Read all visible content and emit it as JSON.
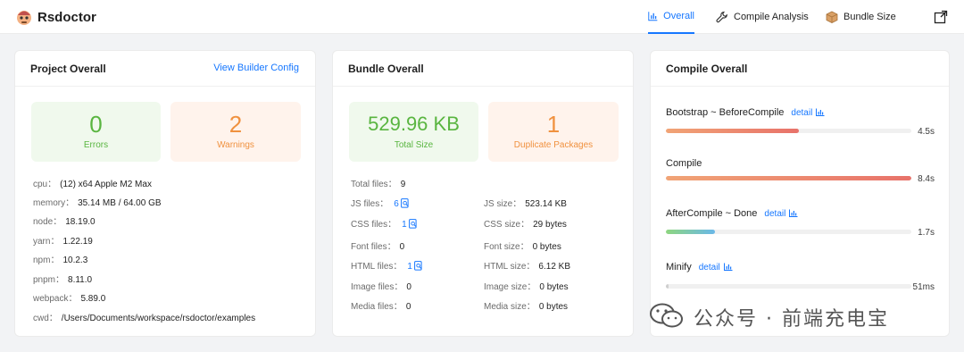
{
  "app": {
    "title": "Rsdoctor"
  },
  "nav": {
    "overall": "Overall",
    "compile_analysis": "Compile Analysis",
    "bundle_size": "Bundle Size"
  },
  "project": {
    "title": "Project Overall",
    "link": "View Builder Config",
    "errors": {
      "value": "0",
      "label": "Errors"
    },
    "warnings": {
      "value": "2",
      "label": "Warnings"
    },
    "info": [
      {
        "key": "cpu：",
        "value": "(12) x64 Apple M2 Max"
      },
      {
        "key": "memory：",
        "value": "35.14 MB / 64.00 GB"
      },
      {
        "key": "node：",
        "value": "18.19.0"
      },
      {
        "key": "yarn：",
        "value": "1.22.19"
      },
      {
        "key": "npm：",
        "value": "10.2.3"
      },
      {
        "key": "pnpm：",
        "value": "8.11.0"
      },
      {
        "key": "webpack：",
        "value": "5.89.0"
      },
      {
        "key": "cwd：",
        "value": "/Users/Documents/workspace/rsdoctor/examples"
      }
    ]
  },
  "bundle": {
    "title": "Bundle Overall",
    "total_size": {
      "value": "529.96 KB",
      "label": "Total Size"
    },
    "duplicates": {
      "value": "1",
      "label": "Duplicate Packages"
    },
    "left": [
      {
        "key": "Total files：",
        "value": "9"
      },
      {
        "key": "JS files：",
        "value": "6"
      },
      {
        "key": "CSS files：",
        "value": "1"
      },
      {
        "key": "Font files：",
        "value": "0"
      },
      {
        "key": "HTML files：",
        "value": "1"
      },
      {
        "key": "Image files：",
        "value": "0"
      },
      {
        "key": "Media files：",
        "value": "0"
      }
    ],
    "right": [
      {
        "key": "JS size：",
        "value": "523.14 KB"
      },
      {
        "key": "CSS size：",
        "value": "29 bytes"
      },
      {
        "key": "Font size：",
        "value": "0 bytes"
      },
      {
        "key": "HTML size：",
        "value": "6.12 KB"
      },
      {
        "key": "Image size：",
        "value": "0 bytes"
      },
      {
        "key": "Media size：",
        "value": "0 bytes"
      }
    ]
  },
  "compile": {
    "title": "Compile Overall",
    "detail_label": "detail",
    "phases": [
      {
        "name": "Bootstrap ~ BeforeCompile",
        "has_detail": true,
        "duration": "4.5s",
        "progress": 0.54,
        "color": "warm"
      },
      {
        "name": "Compile",
        "has_detail": false,
        "duration": "8.4s",
        "progress": 1.0,
        "color": "warm"
      },
      {
        "name": "AfterCompile ~ Done",
        "has_detail": true,
        "duration": "1.7s",
        "progress": 0.2,
        "color": "cool"
      },
      {
        "name": "Minify",
        "has_detail": true,
        "duration": "51ms",
        "progress": 0.01,
        "color": "gray"
      }
    ]
  },
  "watermark": {
    "text": "公众号 · 前端充电宝"
  },
  "colors": {
    "accent": "#1677ff",
    "success": "#59b540",
    "warning": "#f0913f"
  }
}
